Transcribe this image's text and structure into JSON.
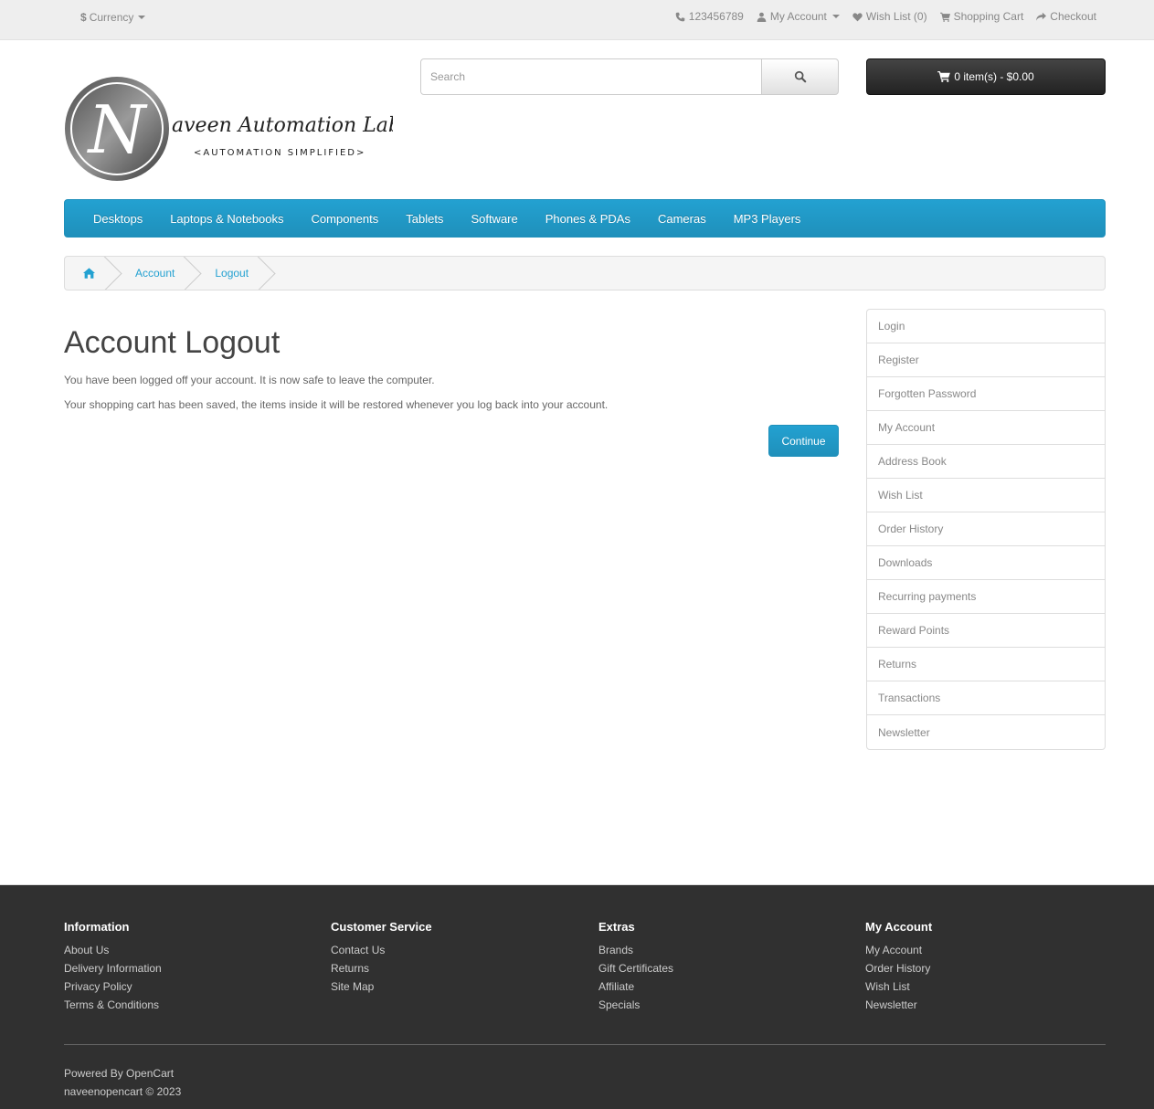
{
  "top_bar": {
    "currency_symbol": "$",
    "currency_label": "Currency",
    "phone": "123456789",
    "my_account": "My Account",
    "wish_list": "Wish List (0)",
    "shopping_cart": "Shopping Cart",
    "checkout": "Checkout"
  },
  "logo": {
    "letter": "N",
    "name": "aveen Automation Labs",
    "tagline": "<AUTOMATION SIMPLIFIED>"
  },
  "search": {
    "placeholder": "Search"
  },
  "cart": {
    "label": "0 item(s) - $0.00"
  },
  "menu": {
    "items": [
      "Desktops",
      "Laptops & Notebooks",
      "Components",
      "Tablets",
      "Software",
      "Phones & PDAs",
      "Cameras",
      "MP3 Players"
    ]
  },
  "breadcrumb": {
    "items": [
      "Account",
      "Logout"
    ]
  },
  "content": {
    "title": "Account Logout",
    "para1": "You have been logged off your account. It is now safe to leave the computer.",
    "para2": "Your shopping cart has been saved, the items inside it will be restored whenever you log back into your account.",
    "continue_label": "Continue"
  },
  "sidebar": {
    "items": [
      "Login",
      "Register",
      "Forgotten Password",
      "My Account",
      "Address Book",
      "Wish List",
      "Order History",
      "Downloads",
      "Recurring payments",
      "Reward Points",
      "Returns",
      "Transactions",
      "Newsletter"
    ]
  },
  "footer": {
    "columns": [
      {
        "heading": "Information",
        "links": [
          "About Us",
          "Delivery Information",
          "Privacy Policy",
          "Terms & Conditions"
        ]
      },
      {
        "heading": "Customer Service",
        "links": [
          "Contact Us",
          "Returns",
          "Site Map"
        ]
      },
      {
        "heading": "Extras",
        "links": [
          "Brands",
          "Gift Certificates",
          "Affiliate",
          "Specials"
        ]
      },
      {
        "heading": "My Account",
        "links": [
          "My Account",
          "Order History",
          "Wish List",
          "Newsletter"
        ]
      }
    ],
    "powered_prefix": "Powered By ",
    "powered_link": "OpenCart",
    "copyright": "naveenopencart © 2023"
  },
  "colors": {
    "accent": "#23a1d1",
    "footer_bg": "#303030",
    "topbar_bg": "#eeeeee"
  }
}
